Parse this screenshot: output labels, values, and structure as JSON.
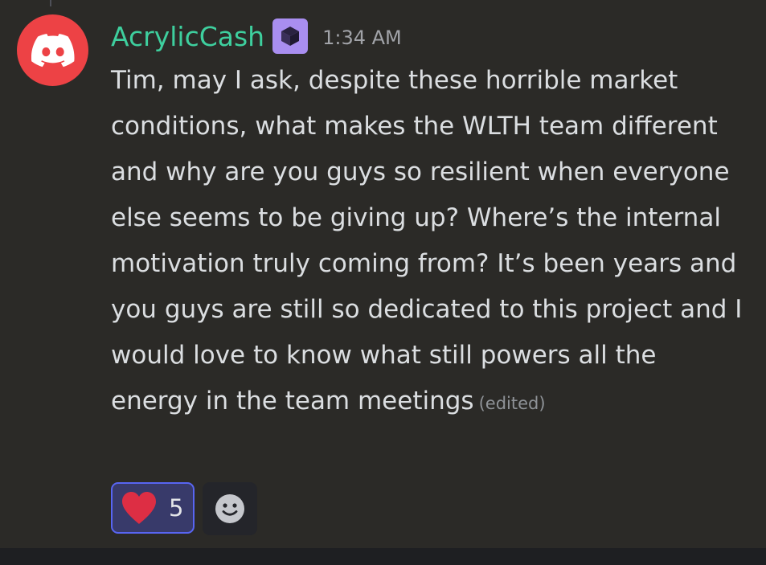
{
  "message": {
    "author": "AcrylicCash",
    "timestamp": "1:34 AM",
    "text": "Tim, may I ask, despite these horrible market conditions, what makes the WLTH team different and why are you guys so resilient when everyone else seems to be giving up? Where’s the internal motivation truly coming from? It’s been years and you guys are still so dedicated to this project and I would love to know what still powers all the energy in the team meetings",
    "edited_label": "(edited)",
    "avatar_icon": "discord-logo-icon",
    "role_icon": "cube-icon"
  },
  "reactions": [
    {
      "emoji_icon": "red-heart-icon",
      "count": "5"
    }
  ],
  "add_reaction_icon": "smiley-face-icon",
  "colors": {
    "background": "#2b2a27",
    "username": "#3ecf9e",
    "avatar": "#ed4245",
    "role_badge": "#a98ef0",
    "reaction_border": "#5865f2"
  }
}
